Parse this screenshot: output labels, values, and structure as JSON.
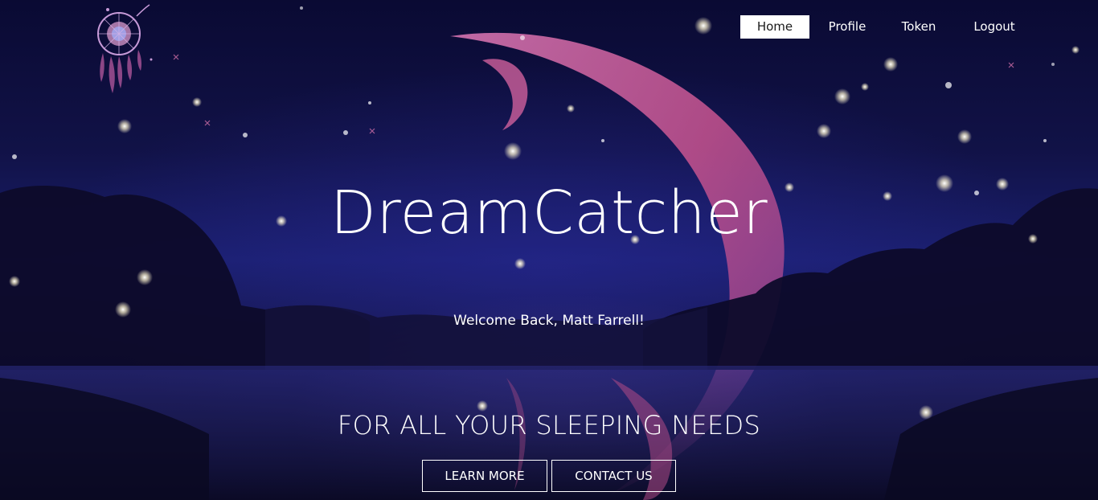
{
  "nav": {
    "items": [
      {
        "label": "Home",
        "active": true
      },
      {
        "label": "Profile",
        "active": false
      },
      {
        "label": "Token",
        "active": false
      },
      {
        "label": "Logout",
        "active": false
      }
    ]
  },
  "hero": {
    "title": "DreamCatcher",
    "welcome": "Welcome Back, Matt Farrell!",
    "tagline": "FOR ALL YOUR SLEEPING NEEDS",
    "learn_more_label": "LEARN MORE",
    "contact_label": "CONTACT US"
  },
  "logo": {
    "icon": "dreamcatcher-icon"
  },
  "colors": {
    "accent": "#ffffff",
    "moon": "#c8538f",
    "sky": "#111247"
  }
}
